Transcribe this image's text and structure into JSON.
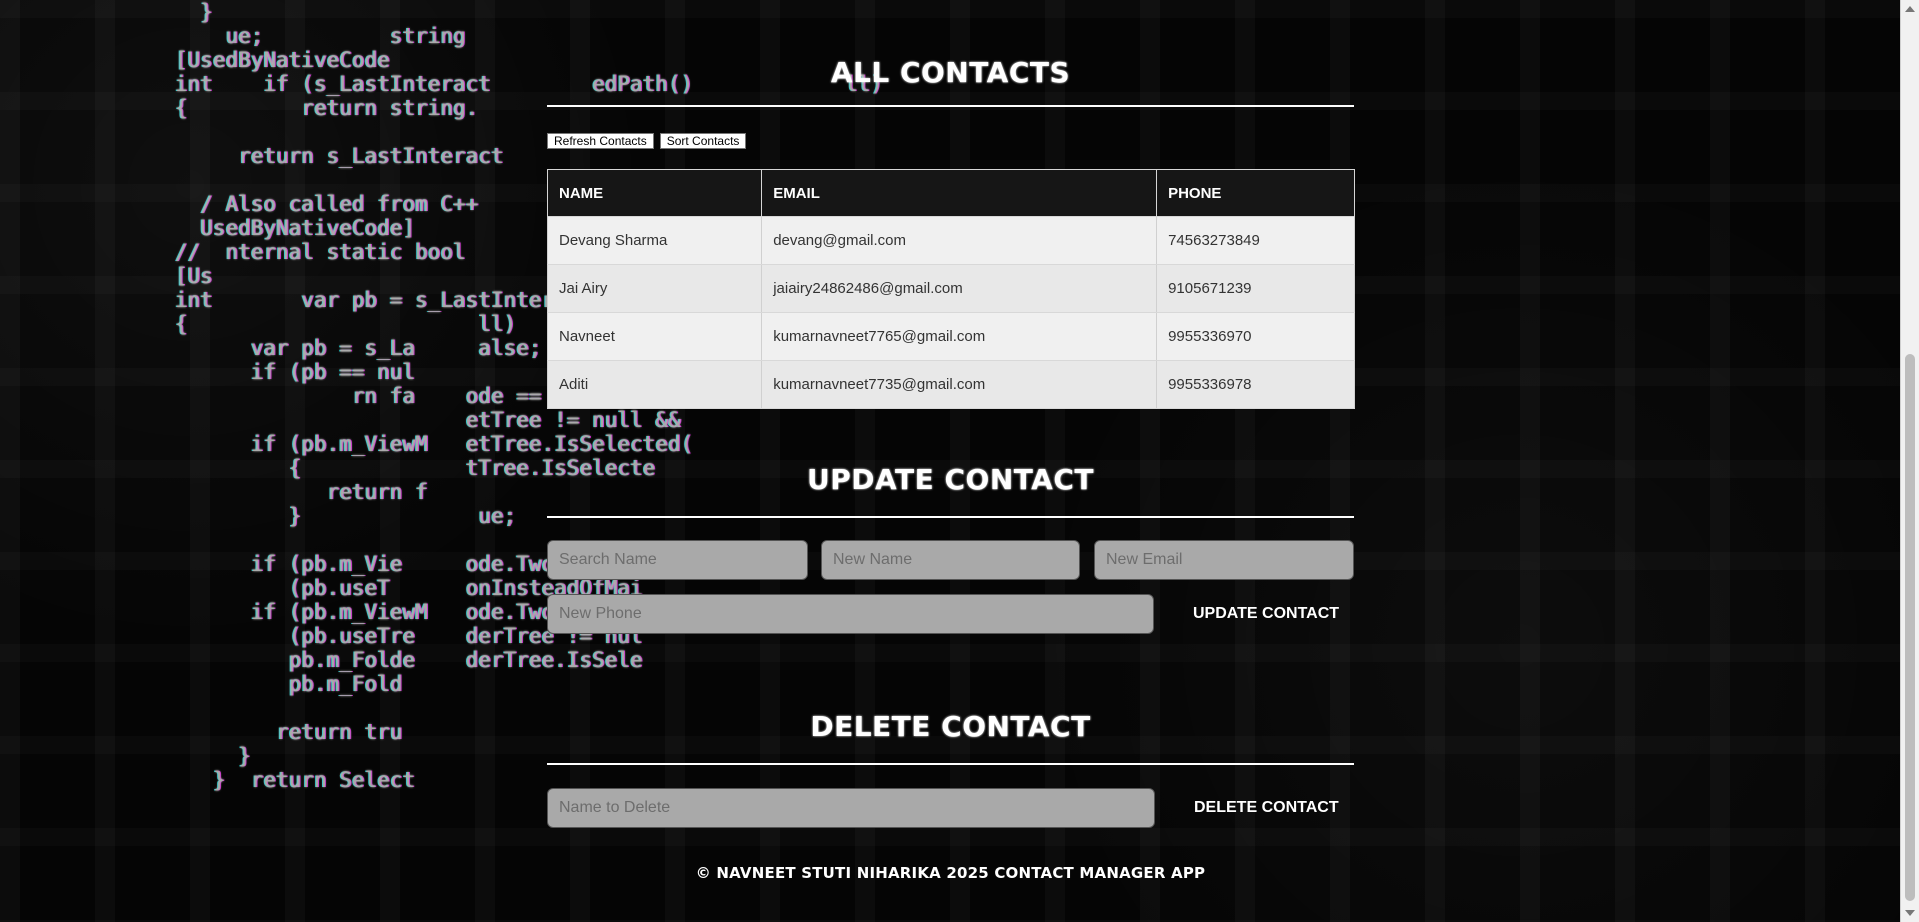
{
  "sections": {
    "all_contacts_title": "All Contacts",
    "update_contact_title": "Update Contact",
    "delete_contact_title": "Delete Contact"
  },
  "buttons": {
    "refresh_contacts": "Refresh Contacts",
    "sort_contacts": "Sort Contacts",
    "update_contact": "UPDATE CONTACT",
    "delete_contact": "DELETE CONTACT"
  },
  "table": {
    "headers": [
      "NAME",
      "EMAIL",
      "PHONE"
    ],
    "rows": [
      [
        "Devang Sharma",
        "devang@gmail.com",
        "74563273849"
      ],
      [
        "Jai Airy",
        "jaiairy24862486@gmail.com",
        "9105671239"
      ],
      [
        "Navneet",
        "kumarnavneet7765@gmail.com",
        "9955336970"
      ],
      [
        "Aditi",
        "kumarnavneet7735@gmail.com",
        "9955336978"
      ]
    ]
  },
  "inputs": {
    "search_name": "Search Name",
    "new_name": "New Name",
    "new_email": "New Email",
    "new_phone": "New Phone",
    "name_to_delete": "Name to Delete"
  },
  "footer": "© Navneet Stuti Niharika 2025 Contact Manager App",
  "background": {
    "code_lines": [
      "  }",
      "    ue;          string",
      "[UsedByNativeCode",
      "int    if (s_LastInteract        edPath()            ll)",
      "{         return string.",
      "",
      "     return s_LastInteract",
      "",
      "  / Also called from C++",
      "  UsedByNativeCode]",
      "//  nternal static bool",
      "[Us",
      "int       var pb = s_LastIntera",
      "{                       ll)",
      "      var pb = s_La     alse;",
      "      if (pb == nul",
      "              rn fa    ode == ViewMode.One",
      "                       etTree != null &&",
      "      if (pb.m_ViewM   etTree.IsSelected(",
      "         {             tTree.IsSelecte",
      "            return f",
      "         }              ue;",
      "",
      "      if (pb.m_Vie     ode.TwoColumns",
      "         (pb.useT      onInsteadOfMai",
      "      if (pb.m_ViewM   ode.TwoColumns &&",
      "         (pb.useTre    derTree != nul",
      "         pb.m_Folde    derTree.IsSele",
      "         pb.m_Fold",
      "",
      "        return tru",
      "     }",
      "   }  return Select"
    ]
  },
  "colors": {
    "background": "#000000",
    "table_header": "#161616",
    "table_body": "#e8e8e8",
    "input": "#a9a9a9",
    "text": "#ffffff"
  }
}
